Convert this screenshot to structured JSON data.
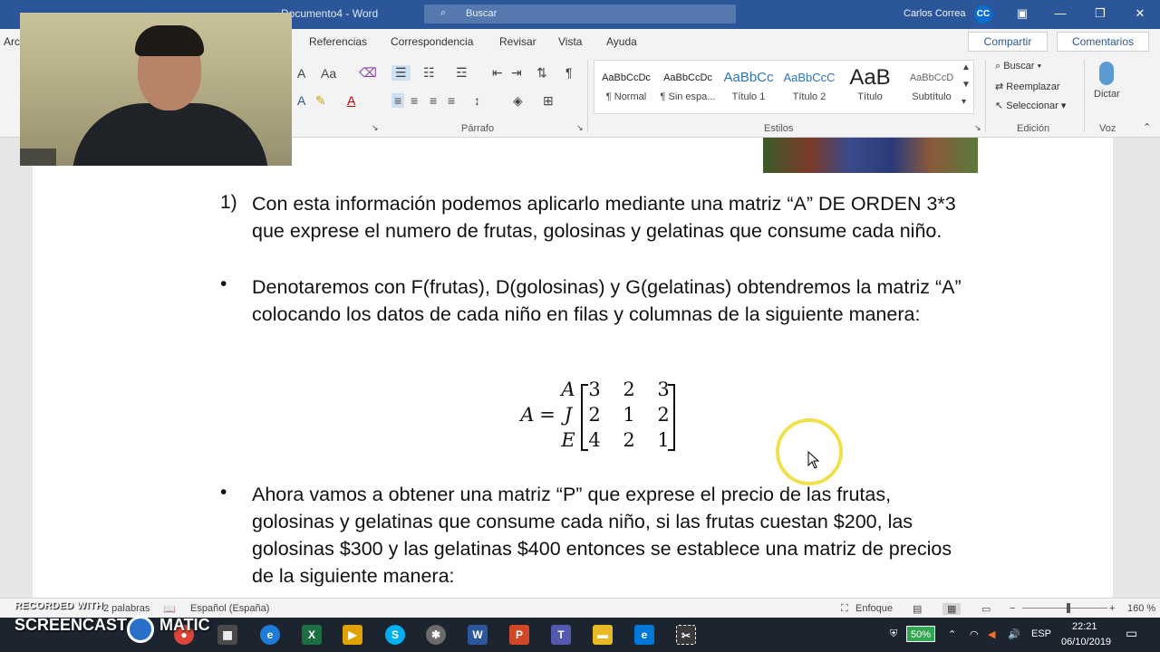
{
  "window": {
    "doc_title": "Documento4 - Word",
    "search_placeholder": "Buscar",
    "user_name": "Carlos Correa",
    "user_initials": "CC"
  },
  "tabs": [
    "Archivo",
    "Referencias",
    "Correspondencia",
    "Revisar",
    "Vista",
    "Ayuda"
  ],
  "share_label": "Compartir",
  "comments_label": "Comentarios",
  "ribbon": {
    "font_size_grow": "A",
    "font_case": "Aa",
    "paragraph_label": "Párrafo",
    "styles_label": "Estilos",
    "editing_label": "Edición",
    "voice_label": "Voz",
    "styles": [
      {
        "sample": "AaBbCcDc",
        "name": "¶ Normal"
      },
      {
        "sample": "AaBbCcDc",
        "name": "¶ Sin espa..."
      },
      {
        "sample": "AaBbCc",
        "name": "Título 1"
      },
      {
        "sample": "AaBbCcC",
        "name": "Título 2"
      },
      {
        "sample": "AaB",
        "name": "Título"
      },
      {
        "sample": "AaBbCcD",
        "name": "Subtítulo"
      }
    ],
    "editing": {
      "find": "Buscar",
      "replace": "Reemplazar",
      "select": "Seleccionar"
    },
    "dictate": "Dictar"
  },
  "document": {
    "item1_number": "1)",
    "item1_text": "Con esta información podemos aplicarlo mediante una matriz “A” DE ORDEN 3*3 que exprese el numero de frutas, golosinas y gelatinas que consume cada niño.",
    "bullet1_text": "Denotaremos con F(frutas), D(golosinas) y G(gelatinas) obtendremos la matriz “A” colocando los datos de cada niño en filas y columnas de la siguiente manera:",
    "matrix": {
      "name": "A",
      "equals": "=",
      "row_labels": [
        "A",
        "J",
        "E"
      ],
      "rows": [
        [
          "3",
          "2",
          "3"
        ],
        [
          "2",
          "1",
          "2"
        ],
        [
          "4",
          "2",
          "1"
        ]
      ]
    },
    "bullet2_text": "Ahora vamos a obtener una matriz “P” que exprese el precio de las frutas, golosinas y gelatinas que consume cada niño, si las frutas cuestan $200, las golosinas $300 y las gelatinas $400 entonces se establece una matriz de precios de la siguiente manera:",
    "bullet_symbol": "•"
  },
  "statusbar": {
    "words": "2 palabras",
    "language": "Español (España)",
    "focus": "Enfoque",
    "zoom": "160 %"
  },
  "watermark": {
    "line1": "RECORDED WITH",
    "word1": "SCREENCAST",
    "word2": "MATIC"
  },
  "taskbar": {
    "battery": "50%",
    "language": "ESP",
    "time": "22:21",
    "date": "06/10/2019"
  },
  "colors": {
    "titlebar": "#2b579a",
    "ribbon": "#f3f3f3",
    "taskbar": "#1c2430"
  }
}
